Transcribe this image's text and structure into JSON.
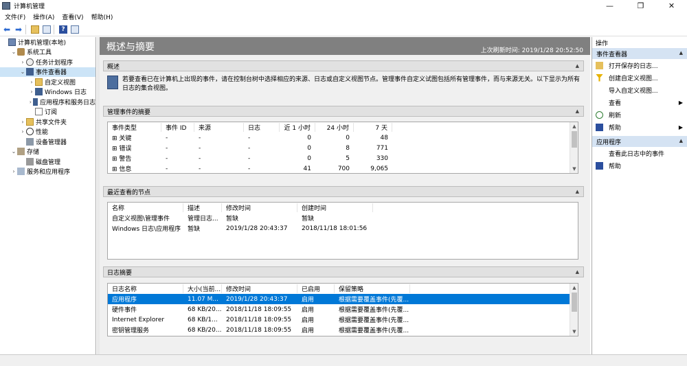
{
  "window": {
    "title": "计算机管理",
    "controls": [
      "—",
      "❐",
      "✕"
    ]
  },
  "menu": [
    "文件(F)",
    "操作(A)",
    "查看(V)",
    "帮助(H)"
  ],
  "tree": [
    {
      "label": "计算机管理(本地)",
      "level": 0,
      "expander": "",
      "icon": "computer-icon"
    },
    {
      "label": "系统工具",
      "level": 1,
      "expander": "⌄",
      "icon": "tools-icon"
    },
    {
      "label": "任务计划程序",
      "level": 2,
      "expander": "›",
      "icon": "clock-icon"
    },
    {
      "label": "事件查看器",
      "level": 2,
      "expander": "⌄",
      "icon": "event-log-icon",
      "selected": true
    },
    {
      "label": "自定义视图",
      "level": 3,
      "expander": "›",
      "icon": "folder-icon"
    },
    {
      "label": "Windows 日志",
      "level": 3,
      "expander": "›",
      "icon": "log-icon"
    },
    {
      "label": "应用程序和服务日志",
      "level": 3,
      "expander": "›",
      "icon": "log-icon"
    },
    {
      "label": "订阅",
      "level": 3,
      "expander": "",
      "icon": "doc-icon"
    },
    {
      "label": "共享文件夹",
      "level": 2,
      "expander": "›",
      "icon": "folder-icon"
    },
    {
      "label": "性能",
      "level": 2,
      "expander": "›",
      "icon": "performance-icon"
    },
    {
      "label": "设备管理器",
      "level": 2,
      "expander": "",
      "icon": "device-manager-icon"
    },
    {
      "label": "存储",
      "level": 1,
      "expander": "⌄",
      "icon": "storage-icon"
    },
    {
      "label": "磁盘管理",
      "level": 2,
      "expander": "",
      "icon": "disk-icon"
    },
    {
      "label": "服务和应用程序",
      "level": 1,
      "expander": "›",
      "icon": "services-icon"
    }
  ],
  "main": {
    "title": "概述与摘要",
    "last_refresh": "上次刷新时间: 2019/1/28 20:52:50",
    "overview": {
      "title": "概述",
      "text": "若要查看已在计算机上出现的事件，请在控制台树中选择相应的来源、日志或自定义视图节点。管理事件自定义试图包括所有管理事件，而与来源无关。以下显示为所有日志的集合视图。"
    },
    "admin_summary": {
      "title": "管理事件的摘要",
      "columns": [
        "事件类型",
        "事件 ID",
        "来源",
        "日志",
        "近 1 小时",
        "24 小时",
        "7 天"
      ],
      "rows": [
        {
          "type": "关键",
          "id": "-",
          "source": "-",
          "log": "-",
          "h1": "0",
          "h24": "0",
          "d7": "48"
        },
        {
          "type": "错误",
          "id": "-",
          "source": "-",
          "log": "-",
          "h1": "0",
          "h24": "8",
          "d7": "771"
        },
        {
          "type": "警告",
          "id": "-",
          "source": "-",
          "log": "-",
          "h1": "0",
          "h24": "5",
          "d7": "330"
        },
        {
          "type": "信息",
          "id": "-",
          "source": "-",
          "log": "-",
          "h1": "41",
          "h24": "700",
          "d7": "9,065"
        }
      ]
    },
    "recent_nodes": {
      "title": "最近查看的节点",
      "columns": [
        "名称",
        "描述",
        "修改时间",
        "创建时间"
      ],
      "rows": [
        {
          "name": "自定义视图\\管理事件",
          "desc": "管理日志...",
          "modified": "暂缺",
          "created": "暂缺"
        },
        {
          "name": "Windows 日志\\应用程序",
          "desc": "暂缺",
          "modified": "2019/1/28 20:43:37",
          "created": "2018/11/18 18:01:56"
        }
      ]
    },
    "log_summary": {
      "title": "日志摘要",
      "columns": [
        "日志名称",
        "大小(当前...",
        "修改时间",
        "已启用",
        "保留策略"
      ],
      "rows": [
        {
          "name": "应用程序",
          "size": "11.07 M...",
          "modified": "2019/1/28 20:43:37",
          "enabled": "启用",
          "policy": "根据需要覆盖事件(先覆...",
          "selected": true
        },
        {
          "name": "硬件事件",
          "size": "68 KB/20...",
          "modified": "2018/11/18 18:09:55",
          "enabled": "启用",
          "policy": "根据需要覆盖事件(先覆..."
        },
        {
          "name": "Internet Explorer",
          "size": "68 KB/1...",
          "modified": "2018/11/18 18:09:55",
          "enabled": "启用",
          "policy": "根据需要覆盖事件(先覆..."
        },
        {
          "name": "密钥管理服务",
          "size": "68 KB/20...",
          "modified": "2018/11/18 18:09:55",
          "enabled": "启用",
          "policy": "根据需要覆盖事件(先覆..."
        }
      ]
    }
  },
  "actions": {
    "title": "操作",
    "groups": [
      {
        "label": "事件查看器",
        "items": [
          {
            "label": "打开保存的日志...",
            "icon": "open-log-icon",
            "submenu": false
          },
          {
            "label": "创建自定义视图...",
            "icon": "filter-icon",
            "submenu": false
          },
          {
            "label": "导入自定义视图...",
            "icon": "",
            "submenu": false
          },
          {
            "label": "查看",
            "icon": "",
            "submenu": true
          },
          {
            "label": "刷新",
            "icon": "refresh-icon",
            "submenu": false
          },
          {
            "label": "帮助",
            "icon": "help-icon",
            "submenu": true
          }
        ]
      },
      {
        "label": "应用程序",
        "items": [
          {
            "label": "查看此日志中的事件",
            "icon": "",
            "submenu": false
          },
          {
            "label": "帮助",
            "icon": "help-icon",
            "submenu": false
          }
        ]
      }
    ]
  }
}
